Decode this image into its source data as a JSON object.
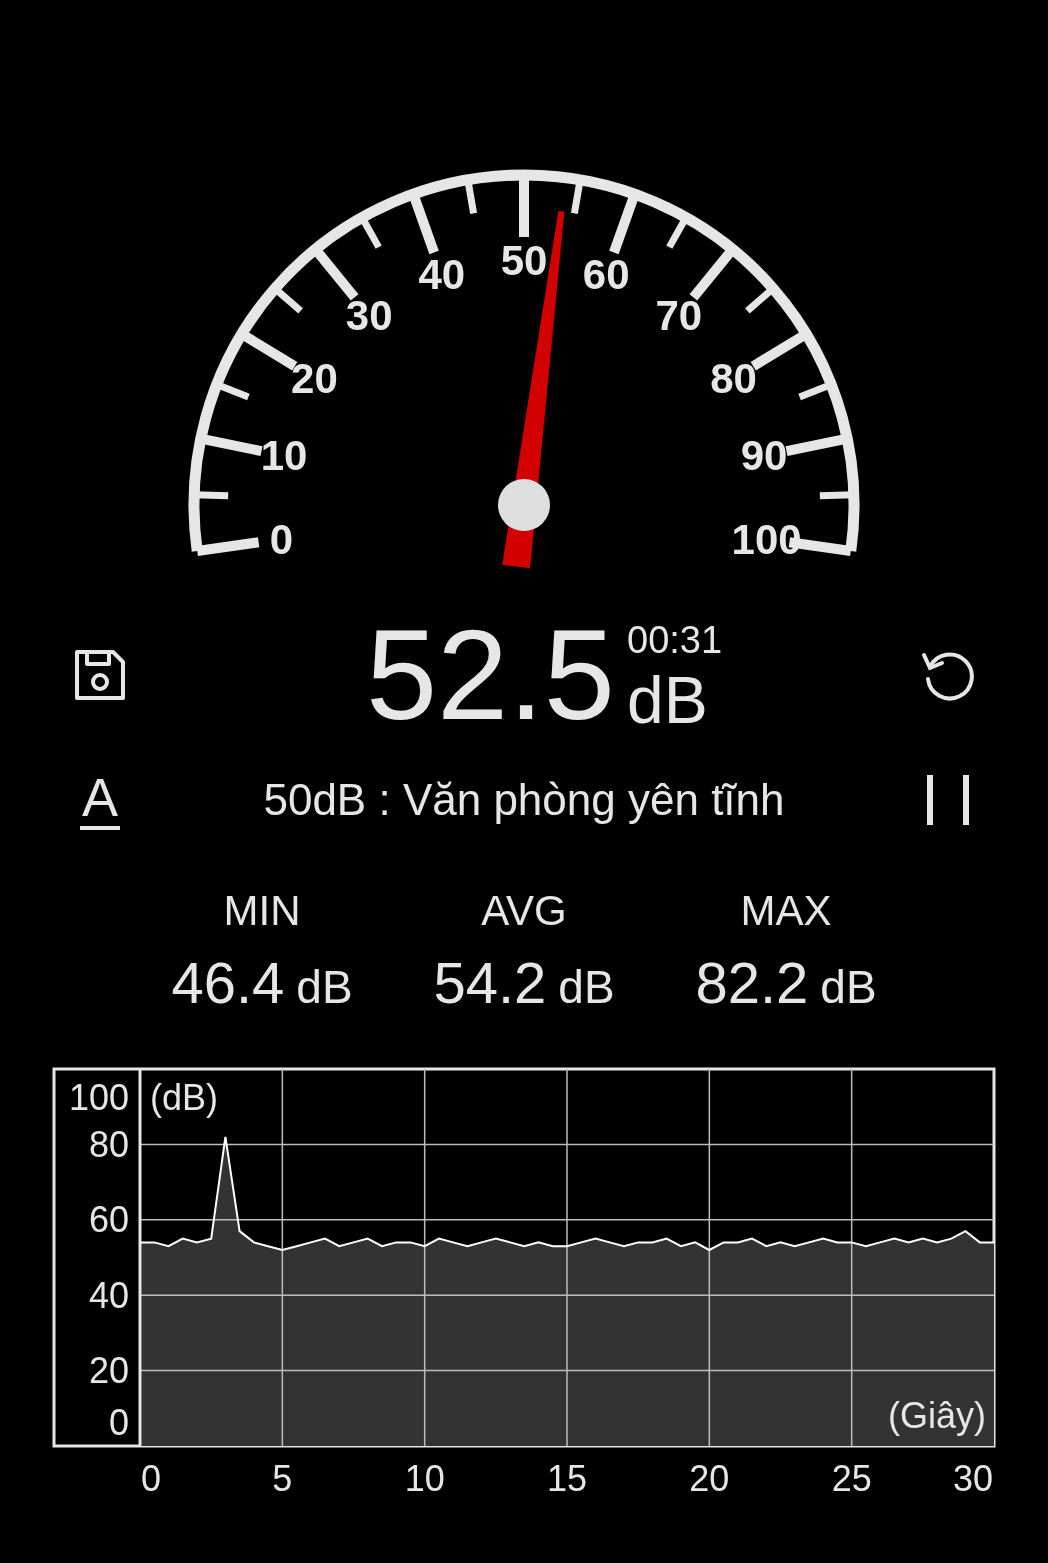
{
  "gauge": {
    "labels": [
      "0",
      "10",
      "20",
      "30",
      "40",
      "50",
      "60",
      "70",
      "80",
      "90",
      "100"
    ]
  },
  "readout": {
    "value": "52.5",
    "elapsed": "00:31",
    "unit": "dB"
  },
  "weighting": "A",
  "reference": "50dB : Văn phòng yên tĩnh",
  "stats": [
    {
      "label": "MIN",
      "value": "46.4",
      "unit": "dB"
    },
    {
      "label": "AVG",
      "value": "54.2",
      "unit": "dB"
    },
    {
      "label": "MAX",
      "value": "82.2",
      "unit": "dB"
    }
  ],
  "chart": {
    "chart_data": {
      "type": "area",
      "ylabel": "(dB)",
      "xlabel": "(Giây)",
      "x": [
        0,
        0.5,
        1,
        1.5,
        2,
        2.5,
        3,
        3.5,
        4,
        4.5,
        5,
        5.5,
        6,
        6.5,
        7,
        7.5,
        8,
        8.5,
        9,
        9.5,
        10,
        10.5,
        11,
        11.5,
        12,
        12.5,
        13,
        13.5,
        14,
        14.5,
        15,
        15.5,
        16,
        16.5,
        17,
        17.5,
        18,
        18.5,
        19,
        19.5,
        20,
        20.5,
        21,
        21.5,
        22,
        22.5,
        23,
        23.5,
        24,
        24.5,
        25,
        25.5,
        26,
        26.5,
        27,
        27.5,
        28,
        28.5,
        29,
        29.5,
        30
      ],
      "series": [
        {
          "color": "#ffffff",
          "values": [
            54,
            54,
            53,
            55,
            54,
            55,
            82,
            57,
            54,
            53,
            52,
            53,
            54,
            55,
            53,
            54,
            55,
            53,
            54,
            54,
            53,
            55,
            54,
            53,
            54,
            55,
            54,
            53,
            54,
            53,
            53,
            54,
            55,
            54,
            53,
            54,
            54,
            55,
            53,
            54,
            52,
            54,
            54,
            55,
            53,
            54,
            53,
            54,
            55,
            54,
            54,
            53,
            54,
            55,
            54,
            55,
            54,
            55,
            57,
            54,
            54
          ]
        }
      ],
      "grid": true,
      "xlim": [
        0,
        30
      ],
      "ylim": [
        0,
        100
      ],
      "xticks": [
        0,
        5,
        10,
        15,
        20,
        25,
        30
      ],
      "yticks": [
        0,
        20,
        40,
        60,
        80,
        100
      ]
    }
  }
}
